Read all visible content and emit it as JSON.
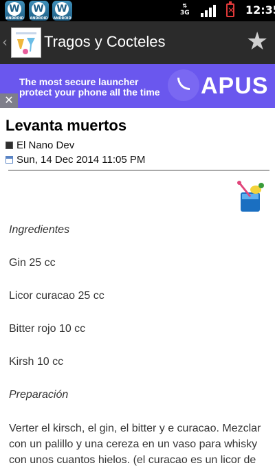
{
  "status_bar": {
    "notification_icons": [
      {
        "name": "wordpress-icon",
        "sub": "ANDROID"
      },
      {
        "name": "wordpress-icon",
        "sub": "ANDROID"
      },
      {
        "name": "wordpress-icon",
        "sub": "ANDROID"
      }
    ],
    "network": "3G",
    "time": "12:35"
  },
  "action_bar": {
    "title": "Tragos y Cocteles"
  },
  "ad": {
    "line1": "The most secure launcher",
    "line2": "protect your phone all the time",
    "brand": "APUS",
    "close_glyph": "✕"
  },
  "article": {
    "title": "Levanta muertos",
    "author": "El Nano Dev",
    "date": "Sun, 14 Dec 2014 11:05 PM",
    "ingredients_heading": "Ingredientes",
    "ingredients": [
      "Gin 25 cc",
      "Licor curacao 25 cc",
      "Bitter rojo 10 cc",
      "Kirsh 10 cc"
    ],
    "preparation_heading": "Preparación",
    "preparation": "Verter el kirsch, el gin, el bitter y e curacao. Mezclar con un palillo y una cereza en un vaso para whisky con unos cuantos hielos. (el curacao es un licor de naranja, el"
  },
  "colors": {
    "status_bar": "#000000",
    "action_bar": "#2b2b2b",
    "ad_background": "#6a57ee",
    "page_background": "#ffffff"
  }
}
